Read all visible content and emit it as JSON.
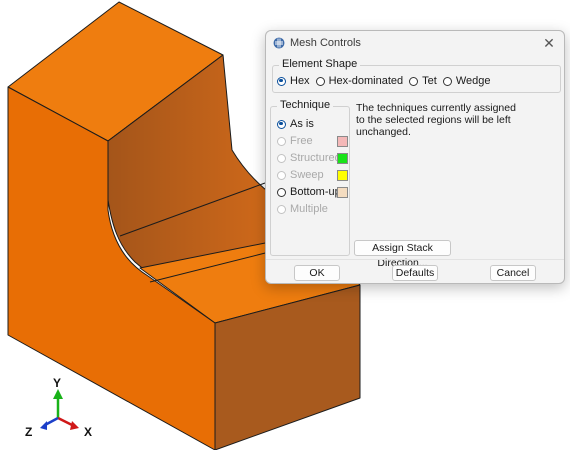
{
  "dialog": {
    "title": "Mesh Controls",
    "element_shape": {
      "label": "Element Shape",
      "options": [
        "Hex",
        "Hex-dominated",
        "Tet",
        "Wedge"
      ],
      "selected": "Hex"
    },
    "technique": {
      "label": "Technique",
      "options": [
        {
          "label": "As is",
          "enabled": true,
          "selected": true
        },
        {
          "label": "Free",
          "enabled": false,
          "color": "#f4b8b8"
        },
        {
          "label": "Structured",
          "enabled": false,
          "color": "#19e319"
        },
        {
          "label": "Sweep",
          "enabled": false,
          "color": "#ffff00"
        },
        {
          "label": "Bottom-up",
          "enabled": true,
          "color": "#f4dcc0"
        },
        {
          "label": "Multiple",
          "enabled": false
        }
      ]
    },
    "info_line1": "The techniques currently assigned",
    "info_line2": "to the selected regions will be left unchanged.",
    "assign_button": "Assign Stack Direction...",
    "ok_button": "OK",
    "defaults_button": "Defaults",
    "cancel_button": "Cancel"
  },
  "triad": {
    "x_label": "X",
    "y_label": "Y",
    "z_label": "Z"
  },
  "colors": {
    "part_front": "#e86e05",
    "part_top": "#ef7d0f",
    "part_side": "#a85a1e",
    "edge": "#1c1c1c"
  }
}
